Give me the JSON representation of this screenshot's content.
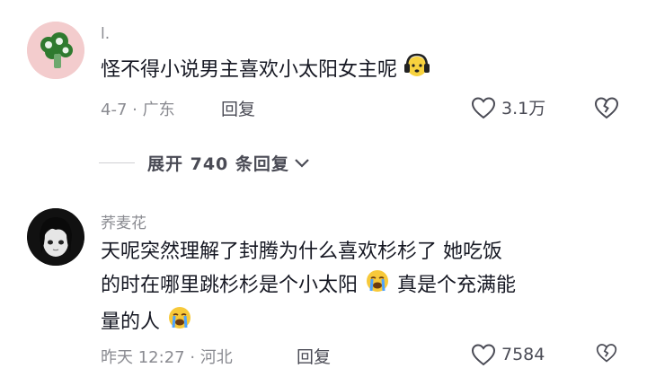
{
  "comments": [
    {
      "username": "l.",
      "text": "怪不得小说男主喜欢小太阳女主呢",
      "meta": "4-7 · 广东",
      "reply_label": "回复",
      "like_count": "3.1万"
    },
    {
      "username": "荞麦花",
      "text_parts": [
        "天呢突然理解了封腾为什么喜欢杉杉了 她吃饭",
        "的时在哪里跳杉杉是个小太阳",
        "真是个充满能",
        "量的人"
      ],
      "meta": "昨天 12:27 · 河北",
      "reply_label": "回复",
      "like_count": "7584"
    }
  ],
  "expand_replies": {
    "label": "展开 740 条回复"
  },
  "icons": {
    "emoji_headphones": "headphones-face-emoji",
    "emoji_crying": "crying-face-emoji",
    "like": "heart-outline-icon",
    "dislike": "broken-heart-icon",
    "chevron": "chevron-down-icon"
  }
}
